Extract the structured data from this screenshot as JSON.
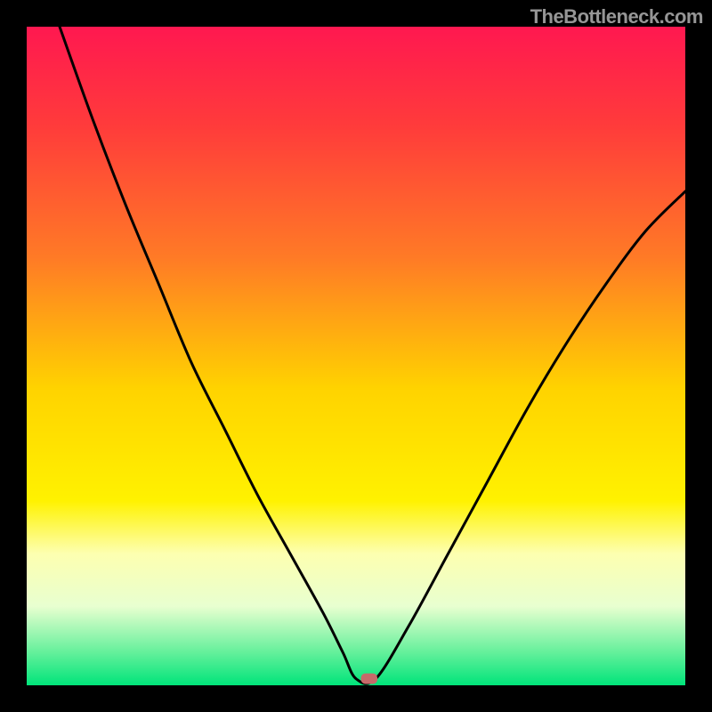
{
  "watermark": "TheBottleneck.com",
  "chart_data": {
    "type": "line",
    "title": "",
    "xlabel": "",
    "ylabel": "",
    "xlim": [
      0,
      100
    ],
    "ylim": [
      0,
      100
    ],
    "gradient_stops": [
      {
        "offset": 0,
        "color": "#ff1850"
      },
      {
        "offset": 15,
        "color": "#ff3b3b"
      },
      {
        "offset": 35,
        "color": "#ff7a26"
      },
      {
        "offset": 55,
        "color": "#ffd300"
      },
      {
        "offset": 72,
        "color": "#fff200"
      },
      {
        "offset": 80,
        "color": "#fdffb0"
      },
      {
        "offset": 88,
        "color": "#e8ffd0"
      },
      {
        "offset": 95,
        "color": "#64f09b"
      },
      {
        "offset": 100,
        "color": "#00e47a"
      }
    ],
    "series": [
      {
        "name": "bottleneck-curve",
        "segments": [
          {
            "name": "left",
            "x": [
              5,
              10,
              15,
              20,
              25,
              30,
              35,
              40,
              45,
              48,
              50
            ],
            "y": [
              100,
              86,
              73,
              61,
              49,
              39,
              29,
              20,
              11,
              5,
              1
            ]
          },
          {
            "name": "flat",
            "x": [
              50,
              53
            ],
            "y": [
              1,
              1
            ]
          },
          {
            "name": "right",
            "x": [
              53,
              58,
              64,
              70,
              76,
              82,
              88,
              94,
              100
            ],
            "y": [
              1,
              9,
              20,
              31,
              42,
              52,
              61,
              69,
              75
            ]
          }
        ]
      }
    ],
    "marker": {
      "x": 52,
      "y": 1,
      "color": "#c76a6a",
      "width_pct": 2.5,
      "height_pct": 1.6
    }
  }
}
